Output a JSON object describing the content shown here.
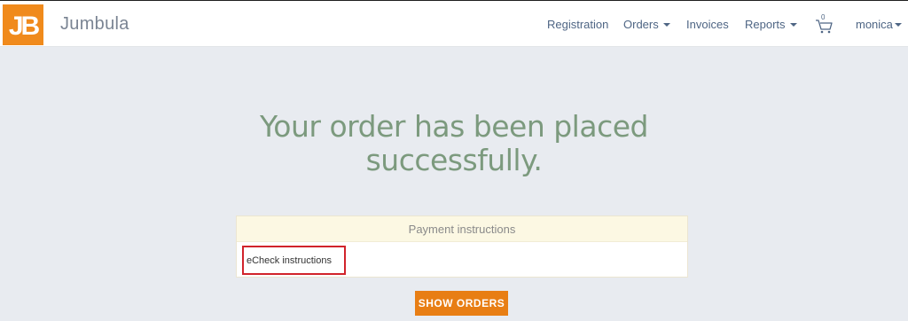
{
  "brand": {
    "logo_text": "JB",
    "name": "Jumbula",
    "logo_color": "#f08a1c"
  },
  "nav": {
    "registration": "Registration",
    "orders": "Orders",
    "invoices": "Invoices",
    "reports": "Reports",
    "cart_count": "0",
    "user": "monica"
  },
  "main": {
    "headline_line1": "Your order has been placed",
    "headline_line2": "successfully.",
    "panel_title": "Payment instructions",
    "panel_body": "eCheck instructions",
    "show_orders": "SHOW ORDERS"
  },
  "colors": {
    "background": "#e8ebf0",
    "accent": "#e87e14",
    "headline": "#7c9a7e",
    "nav_text": "#4e6584",
    "highlight_border": "#d1232b"
  },
  "icons": [
    "shopping-cart-icon",
    "caret-down-icon"
  ]
}
